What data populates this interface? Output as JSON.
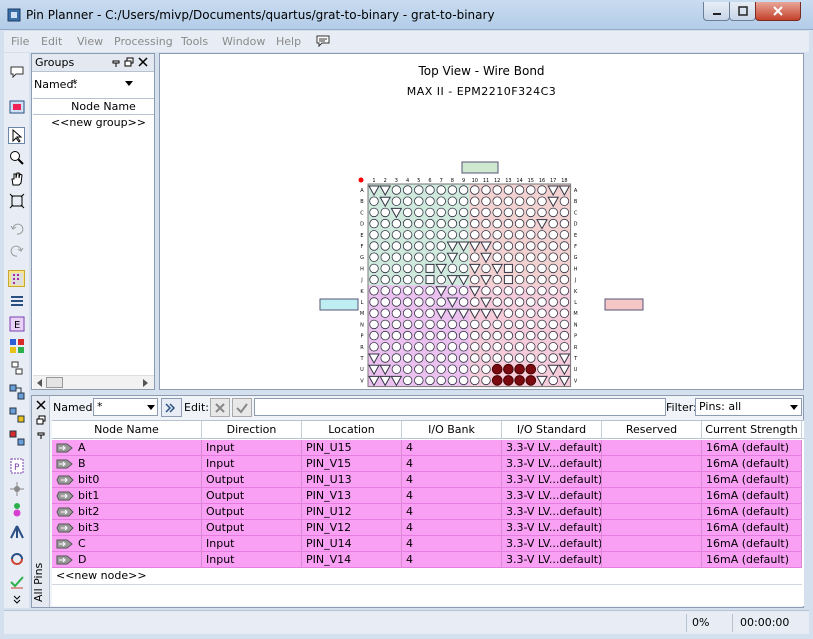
{
  "window": {
    "title": "Pin Planner - C:/Users/mivp/Documents/quartus/grat-to-binary - grat-to-binary"
  },
  "menu": [
    {
      "label": "File"
    },
    {
      "label": "Edit"
    },
    {
      "label": "View"
    },
    {
      "label": "Processing"
    },
    {
      "label": "Tools"
    },
    {
      "label": "Window"
    },
    {
      "label": "Help"
    }
  ],
  "groups": {
    "title": "Groups",
    "named_label": "Named:",
    "named_value": "*",
    "column_header": "Node Name",
    "new_group": "<<new group>>"
  },
  "chip": {
    "title": "Top View - Wire Bond",
    "device": "MAX II - EPM2210F324C3",
    "columns": [
      "1",
      "2",
      "3",
      "4",
      "5",
      "6",
      "7",
      "8",
      "9",
      "10",
      "11",
      "12",
      "13",
      "14",
      "15",
      "16",
      "17",
      "18"
    ],
    "rows": [
      "A",
      "B",
      "C",
      "D",
      "E",
      "F",
      "G",
      "H",
      "J",
      "K",
      "L",
      "M",
      "N",
      "P",
      "R",
      "T",
      "U",
      "V"
    ]
  },
  "pins": {
    "named_label": "Named:",
    "named_value": "*",
    "edit_label": "Edit:",
    "edit_value": "",
    "filter_label": "Filter:",
    "filter_value": "Pins: all",
    "side_tab": "All Pins",
    "columns": [
      "Node Name",
      "Direction",
      "Location",
      "I/O Bank",
      "I/O Standard",
      "Reserved",
      "Current Strength"
    ],
    "rows": [
      {
        "name": "A",
        "direction": "Input",
        "location": "PIN_U15",
        "bank": "4",
        "standard": "3.3-V LV...default)",
        "reserved": "",
        "strength": "16mA (default)",
        "kind": "input"
      },
      {
        "name": "B",
        "direction": "Input",
        "location": "PIN_V15",
        "bank": "4",
        "standard": "3.3-V LV...default)",
        "reserved": "",
        "strength": "16mA (default)",
        "kind": "input"
      },
      {
        "name": "bit0",
        "direction": "Output",
        "location": "PIN_U13",
        "bank": "4",
        "standard": "3.3-V LV...default)",
        "reserved": "",
        "strength": "16mA (default)",
        "kind": "output"
      },
      {
        "name": "bit1",
        "direction": "Output",
        "location": "PIN_V13",
        "bank": "4",
        "standard": "3.3-V LV...default)",
        "reserved": "",
        "strength": "16mA (default)",
        "kind": "output"
      },
      {
        "name": "bit2",
        "direction": "Output",
        "location": "PIN_U12",
        "bank": "4",
        "standard": "3.3-V LV...default)",
        "reserved": "",
        "strength": "16mA (default)",
        "kind": "output"
      },
      {
        "name": "bit3",
        "direction": "Output",
        "location": "PIN_V12",
        "bank": "4",
        "standard": "3.3-V LV...default)",
        "reserved": "",
        "strength": "16mA (default)",
        "kind": "output"
      },
      {
        "name": "C",
        "direction": "Input",
        "location": "PIN_U14",
        "bank": "4",
        "standard": "3.3-V LV...default)",
        "reserved": "",
        "strength": "16mA (default)",
        "kind": "input"
      },
      {
        "name": "D",
        "direction": "Input",
        "location": "PIN_V14",
        "bank": "4",
        "standard": "3.3-V LV...default)",
        "reserved": "",
        "strength": "16mA (default)",
        "kind": "input"
      }
    ],
    "new_node": "<<new node>>"
  },
  "status": {
    "progress": "0%",
    "time": "00:00:00"
  },
  "colors": {
    "row_bg": "#f99ff4",
    "bank_cyan": "#c8eef0",
    "bank_pink": "#f6cfd0",
    "bank_magenta": "#f0b8ee",
    "bank_green": "#d4e8d0",
    "used_pin": "#7a0a10"
  }
}
